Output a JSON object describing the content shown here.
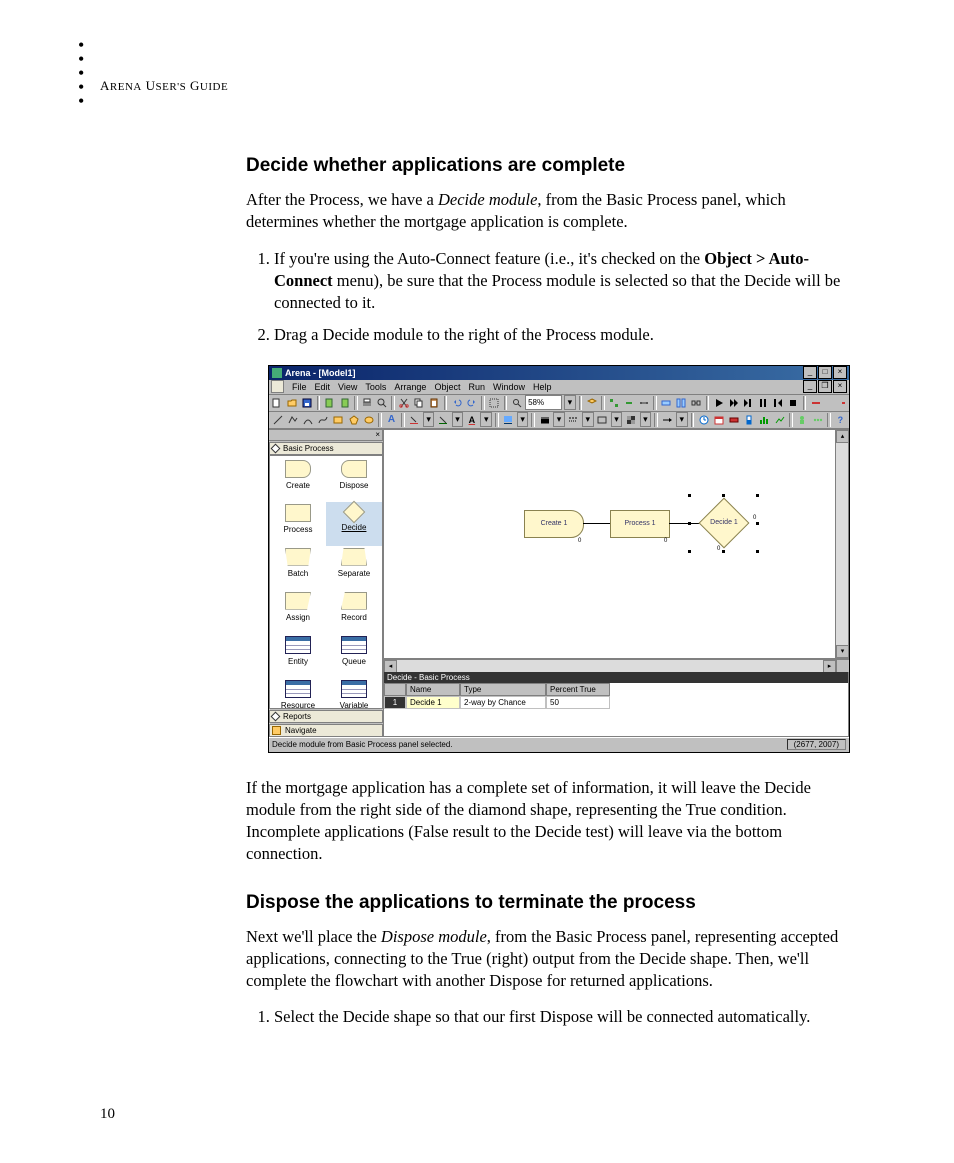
{
  "header": "ARENA USER'S GUIDE",
  "page_number": "10",
  "section1": {
    "title": "Decide whether applications are complete",
    "para1_pre": "After the Process, we have a ",
    "para1_em": "Decide module",
    "para1_post": ", from the Basic Process panel, which determines whether the mortgage application is complete.",
    "step1_pre": "If you're using the Auto-Connect feature (i.e., it's checked on the ",
    "step1_bold": "Object > Auto-Connect",
    "step1_post": " menu), be sure that the Process module is selected so that the Decide will be connected to it.",
    "step2": "Drag a Decide module to the right of the Process module.",
    "para2": "If the mortgage application has a complete set of information, it will leave the Decide module from the right side of the diamond shape, representing the True condition. Incomplete applications (False result to the Decide test) will leave via the bottom connection."
  },
  "section2": {
    "title": "Dispose the applications to terminate the process",
    "para1_pre": "Next we'll place the ",
    "para1_em": "Dispose module",
    "para1_post": ", from the Basic Process panel, representing accepted applications, connecting to the True (right) output from the Decide shape. Then, we'll complete the flowchart with another Dispose for returned applications.",
    "step1": "Select the Decide shape so that our first Dispose will be connected automatically."
  },
  "app": {
    "title": "Arena - [Model1]",
    "menus": [
      "File",
      "Edit",
      "View",
      "Tools",
      "Arrange",
      "Object",
      "Run",
      "Window",
      "Help"
    ],
    "zoom": "58%",
    "panel": {
      "title": "Basic Process",
      "modules": [
        "Create",
        "Dispose",
        "Process",
        "Decide",
        "Batch",
        "Separate",
        "Assign",
        "Record",
        "Entity",
        "Queue",
        "Resource",
        "Variable"
      ],
      "tabs": [
        "Reports",
        "Navigate"
      ]
    },
    "flow": {
      "create": "Create 1",
      "process": "Process 1",
      "decide": "Decide 1",
      "zero": "0"
    },
    "sheet": {
      "header": "Decide - Basic Process",
      "cols": [
        "Name",
        "Type",
        "Percent True"
      ],
      "row": {
        "idx": "1",
        "name": "Decide 1",
        "type": "2-way by Chance",
        "pt": "50"
      }
    },
    "status": "Decide module from Basic Process panel selected.",
    "coords": "(2677, 2007)"
  }
}
